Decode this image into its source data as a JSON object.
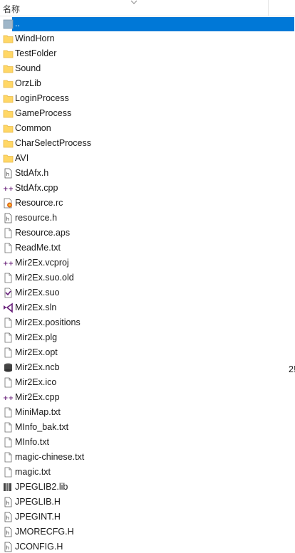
{
  "header": {
    "name_label": "名称"
  },
  "files": [
    {
      "name": "..",
      "icon": "up-folder-icon",
      "selected": true
    },
    {
      "name": "WindHorn",
      "icon": "folder-icon"
    },
    {
      "name": "TestFolder",
      "icon": "folder-icon"
    },
    {
      "name": "Sound",
      "icon": "folder-icon"
    },
    {
      "name": "OrzLib",
      "icon": "folder-icon"
    },
    {
      "name": "LoginProcess",
      "icon": "folder-icon"
    },
    {
      "name": "GameProcess",
      "icon": "folder-icon"
    },
    {
      "name": "Common",
      "icon": "folder-icon"
    },
    {
      "name": "CharSelectProcess",
      "icon": "folder-icon"
    },
    {
      "name": "AVI",
      "icon": "folder-icon"
    },
    {
      "name": "StdAfx.h",
      "icon": "header-file-icon"
    },
    {
      "name": "StdAfx.cpp",
      "icon": "cpp-file-icon"
    },
    {
      "name": "Resource.rc",
      "icon": "resource-file-icon"
    },
    {
      "name": "resource.h",
      "icon": "header-file-icon"
    },
    {
      "name": "Resource.aps",
      "icon": "blank-file-icon"
    },
    {
      "name": "ReadMe.txt",
      "icon": "text-file-icon"
    },
    {
      "name": "Mir2Ex.vcproj",
      "icon": "cpp-file-icon"
    },
    {
      "name": "Mir2Ex.suo.old",
      "icon": "blank-file-icon"
    },
    {
      "name": "Mir2Ex.suo",
      "icon": "vs-file-icon"
    },
    {
      "name": "Mir2Ex.sln",
      "icon": "vs-solution-icon"
    },
    {
      "name": "Mir2Ex.positions",
      "icon": "blank-file-icon"
    },
    {
      "name": "Mir2Ex.plg",
      "icon": "blank-file-icon"
    },
    {
      "name": "Mir2Ex.opt",
      "icon": "blank-file-icon"
    },
    {
      "name": "Mir2Ex.ncb",
      "icon": "database-file-icon"
    },
    {
      "name": "Mir2Ex.ico",
      "icon": "blank-file-icon"
    },
    {
      "name": "Mir2Ex.cpp",
      "icon": "cpp-file-icon"
    },
    {
      "name": "MiniMap.txt",
      "icon": "text-file-icon"
    },
    {
      "name": "MInfo_bak.txt",
      "icon": "text-file-icon"
    },
    {
      "name": "MInfo.txt",
      "icon": "text-file-icon"
    },
    {
      "name": "magic-chinese.txt",
      "icon": "text-file-icon"
    },
    {
      "name": "magic.txt",
      "icon": "text-file-icon"
    },
    {
      "name": "JPEGLIB2.lib",
      "icon": "lib-file-icon"
    },
    {
      "name": "JPEGLIB.H",
      "icon": "header-file-icon"
    },
    {
      "name": "JPEGINT.H",
      "icon": "header-file-icon"
    },
    {
      "name": "JMORECFG.H",
      "icon": "header-file-icon"
    },
    {
      "name": "JCONFIG.H",
      "icon": "header-file-icon"
    }
  ],
  "partial_column_text": "2!",
  "colors": {
    "selection": "#0078d7",
    "folder": "#ffd766",
    "folder_dark": "#e8b94a",
    "cpp_accent": "#68217a"
  }
}
